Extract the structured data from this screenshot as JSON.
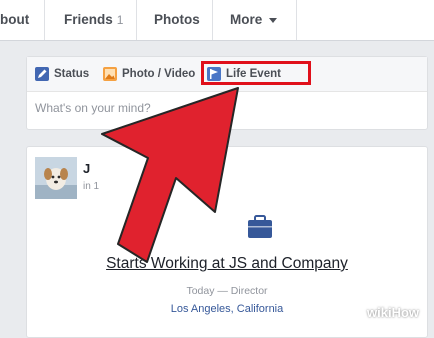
{
  "nav": {
    "about_label": "bout",
    "friends_label": "Friends",
    "friends_count": "1",
    "photos_label": "Photos",
    "more_label": "More"
  },
  "composer": {
    "tabs": [
      {
        "label": "Status",
        "icon": "pencil-icon"
      },
      {
        "label": "Photo / Video",
        "icon": "photo-icon"
      },
      {
        "label": "Life Event",
        "icon": "flag-icon"
      }
    ],
    "placeholder": "What's on your mind?"
  },
  "post": {
    "name_partial": "J",
    "sub_partial": "in 1",
    "event_icon": "briefcase-icon",
    "event_title": "Starts Working at JS and Company",
    "event_sub": "Today — Director",
    "event_location": "Los Angeles, California"
  },
  "watermark": "wikiHow",
  "colors": {
    "accent": "#365899",
    "highlight": "#e0101b",
    "arrow": "#e0222e"
  }
}
